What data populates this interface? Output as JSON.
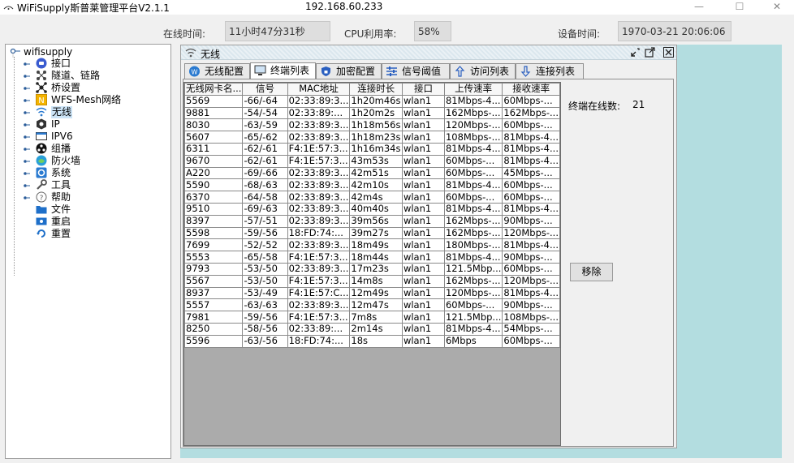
{
  "window": {
    "title": "WiFiSupply斯普莱管理平台V2.1.1",
    "ip": "192.168.60.233",
    "minimize_glyph": "—",
    "maximize_glyph": "☐",
    "close_glyph": "✕"
  },
  "status": {
    "online_time_label": "在线时间:",
    "online_time_value": "11小时47分31秒",
    "cpu_label": "CPU利用率:",
    "cpu_value": "58%",
    "device_time_label": "设备时间:",
    "device_time_value": "1970-03-21 20:06:06"
  },
  "tree": {
    "root": "wifisupply",
    "items": [
      {
        "label": "接口",
        "icon": "interface-icon"
      },
      {
        "label": "隧道、链路",
        "icon": "tunnel-icon"
      },
      {
        "label": "桥设置",
        "icon": "bridge-icon"
      },
      {
        "label": "WFS-Mesh网络",
        "icon": "mesh-icon"
      },
      {
        "label": "无线",
        "icon": "wifi-icon"
      },
      {
        "label": "IP",
        "icon": "ip-icon"
      },
      {
        "label": "IPV6",
        "icon": "ipv6-icon"
      },
      {
        "label": "组播",
        "icon": "multicast-icon"
      },
      {
        "label": "防火墙",
        "icon": "firewall-icon"
      },
      {
        "label": "系统",
        "icon": "system-icon"
      },
      {
        "label": "工具",
        "icon": "tools-icon"
      },
      {
        "label": "帮助",
        "icon": "help-icon"
      },
      {
        "label": "文件",
        "icon": "folder-icon"
      },
      {
        "label": "重启",
        "icon": "reboot-icon"
      },
      {
        "label": "重置",
        "icon": "reset-icon"
      }
    ]
  },
  "panel": {
    "title": "无线",
    "tabs": [
      {
        "label": "无线配置",
        "icon": "wireless-config-icon"
      },
      {
        "label": "终端列表",
        "icon": "terminal-list-icon"
      },
      {
        "label": "加密配置",
        "icon": "shield-icon"
      },
      {
        "label": "信号阈值",
        "icon": "sliders-icon"
      },
      {
        "label": "访问列表",
        "icon": "arrow-up-icon"
      },
      {
        "label": "连接列表",
        "icon": "arrow-down-icon"
      }
    ],
    "active_tab": 1
  },
  "table": {
    "columns": [
      "无线网卡名...",
      "信号",
      "MAC地址",
      "连接时长",
      "接口",
      "上传速率",
      "接收速率"
    ],
    "rows": [
      [
        "5569",
        "-66/-64",
        "02:33:89:3...",
        "1h20m46s",
        "wlan1",
        "81Mbps-4...",
        "60Mbps-..."
      ],
      [
        "9881",
        "-54/-54",
        "02:33:89:...",
        "1h20m2s",
        "wlan1",
        "162Mbps-...",
        "162Mbps-..."
      ],
      [
        "8030",
        "-63/-59",
        "02:33:89:3...",
        "1h18m56s",
        "wlan1",
        "120Mbps-...",
        "60Mbps-..."
      ],
      [
        "5607",
        "-65/-62",
        "02:33:89:3...",
        "1h18m23s",
        "wlan1",
        "108Mbps-...",
        "81Mbps-4..."
      ],
      [
        "6311",
        "-62/-61",
        "F4:1E:57:3...",
        "1h16m34s",
        "wlan1",
        "81Mbps-4...",
        "81Mbps-4..."
      ],
      [
        "9670",
        "-62/-61",
        "F4:1E:57:3...",
        "43m53s",
        "wlan1",
        "60Mbps-...",
        "81Mbps-4..."
      ],
      [
        "A220",
        "-69/-66",
        "02:33:89:3...",
        "42m51s",
        "wlan1",
        "60Mbps-...",
        "45Mbps-..."
      ],
      [
        "5590",
        "-68/-63",
        "02:33:89:3...",
        "42m10s",
        "wlan1",
        "81Mbps-4...",
        "60Mbps-..."
      ],
      [
        "6370",
        "-64/-58",
        "02:33:89:3...",
        "42m4s",
        "wlan1",
        "60Mbps-...",
        "60Mbps-..."
      ],
      [
        "9510",
        "-69/-63",
        "02:33:89:3...",
        "40m40s",
        "wlan1",
        "81Mbps-4...",
        "81Mbps-4..."
      ],
      [
        "8397",
        "-57/-51",
        "02:33:89:3...",
        "39m56s",
        "wlan1",
        "162Mbps-...",
        "90Mbps-..."
      ],
      [
        "5598",
        "-59/-56",
        "18:FD:74:...",
        "39m27s",
        "wlan1",
        "162Mbps-...",
        "120Mbps-..."
      ],
      [
        "7699",
        "-52/-52",
        "02:33:89:3...",
        "18m49s",
        "wlan1",
        "180Mbps-...",
        "81Mbps-4..."
      ],
      [
        "5553",
        "-65/-58",
        "F4:1E:57:3...",
        "18m44s",
        "wlan1",
        "81Mbps-4...",
        "90Mbps-..."
      ],
      [
        "9793",
        "-53/-50",
        "02:33:89:3...",
        "17m23s",
        "wlan1",
        "121.5Mbp...",
        "60Mbps-..."
      ],
      [
        "5567",
        "-53/-50",
        "F4:1E:57:3...",
        "14m8s",
        "wlan1",
        "162Mbps-...",
        "120Mbps-..."
      ],
      [
        "8937",
        "-53/-49",
        "F4:1E:57:C...",
        "12m49s",
        "wlan1",
        "120Mbps-...",
        "81Mbps-4..."
      ],
      [
        "5557",
        "-63/-63",
        "02:33:89:3...",
        "12m47s",
        "wlan1",
        "60Mbps-...",
        "90Mbps-..."
      ],
      [
        "7981",
        "-59/-56",
        "F4:1E:57:3...",
        "7m8s",
        "wlan1",
        "121.5Mbp...",
        "108Mbps-..."
      ],
      [
        "8250",
        "-58/-56",
        "02:33:89:...",
        "2m14s",
        "wlan1",
        "81Mbps-4...",
        "54Mbps-..."
      ],
      [
        "5596",
        "-63/-56",
        "18:FD:74:...",
        "18s",
        "wlan1",
        "6Mbps",
        "60Mbps-..."
      ]
    ]
  },
  "side": {
    "online_count_label": "终端在线数:",
    "online_count_value": "21",
    "remove_button": "移除"
  }
}
